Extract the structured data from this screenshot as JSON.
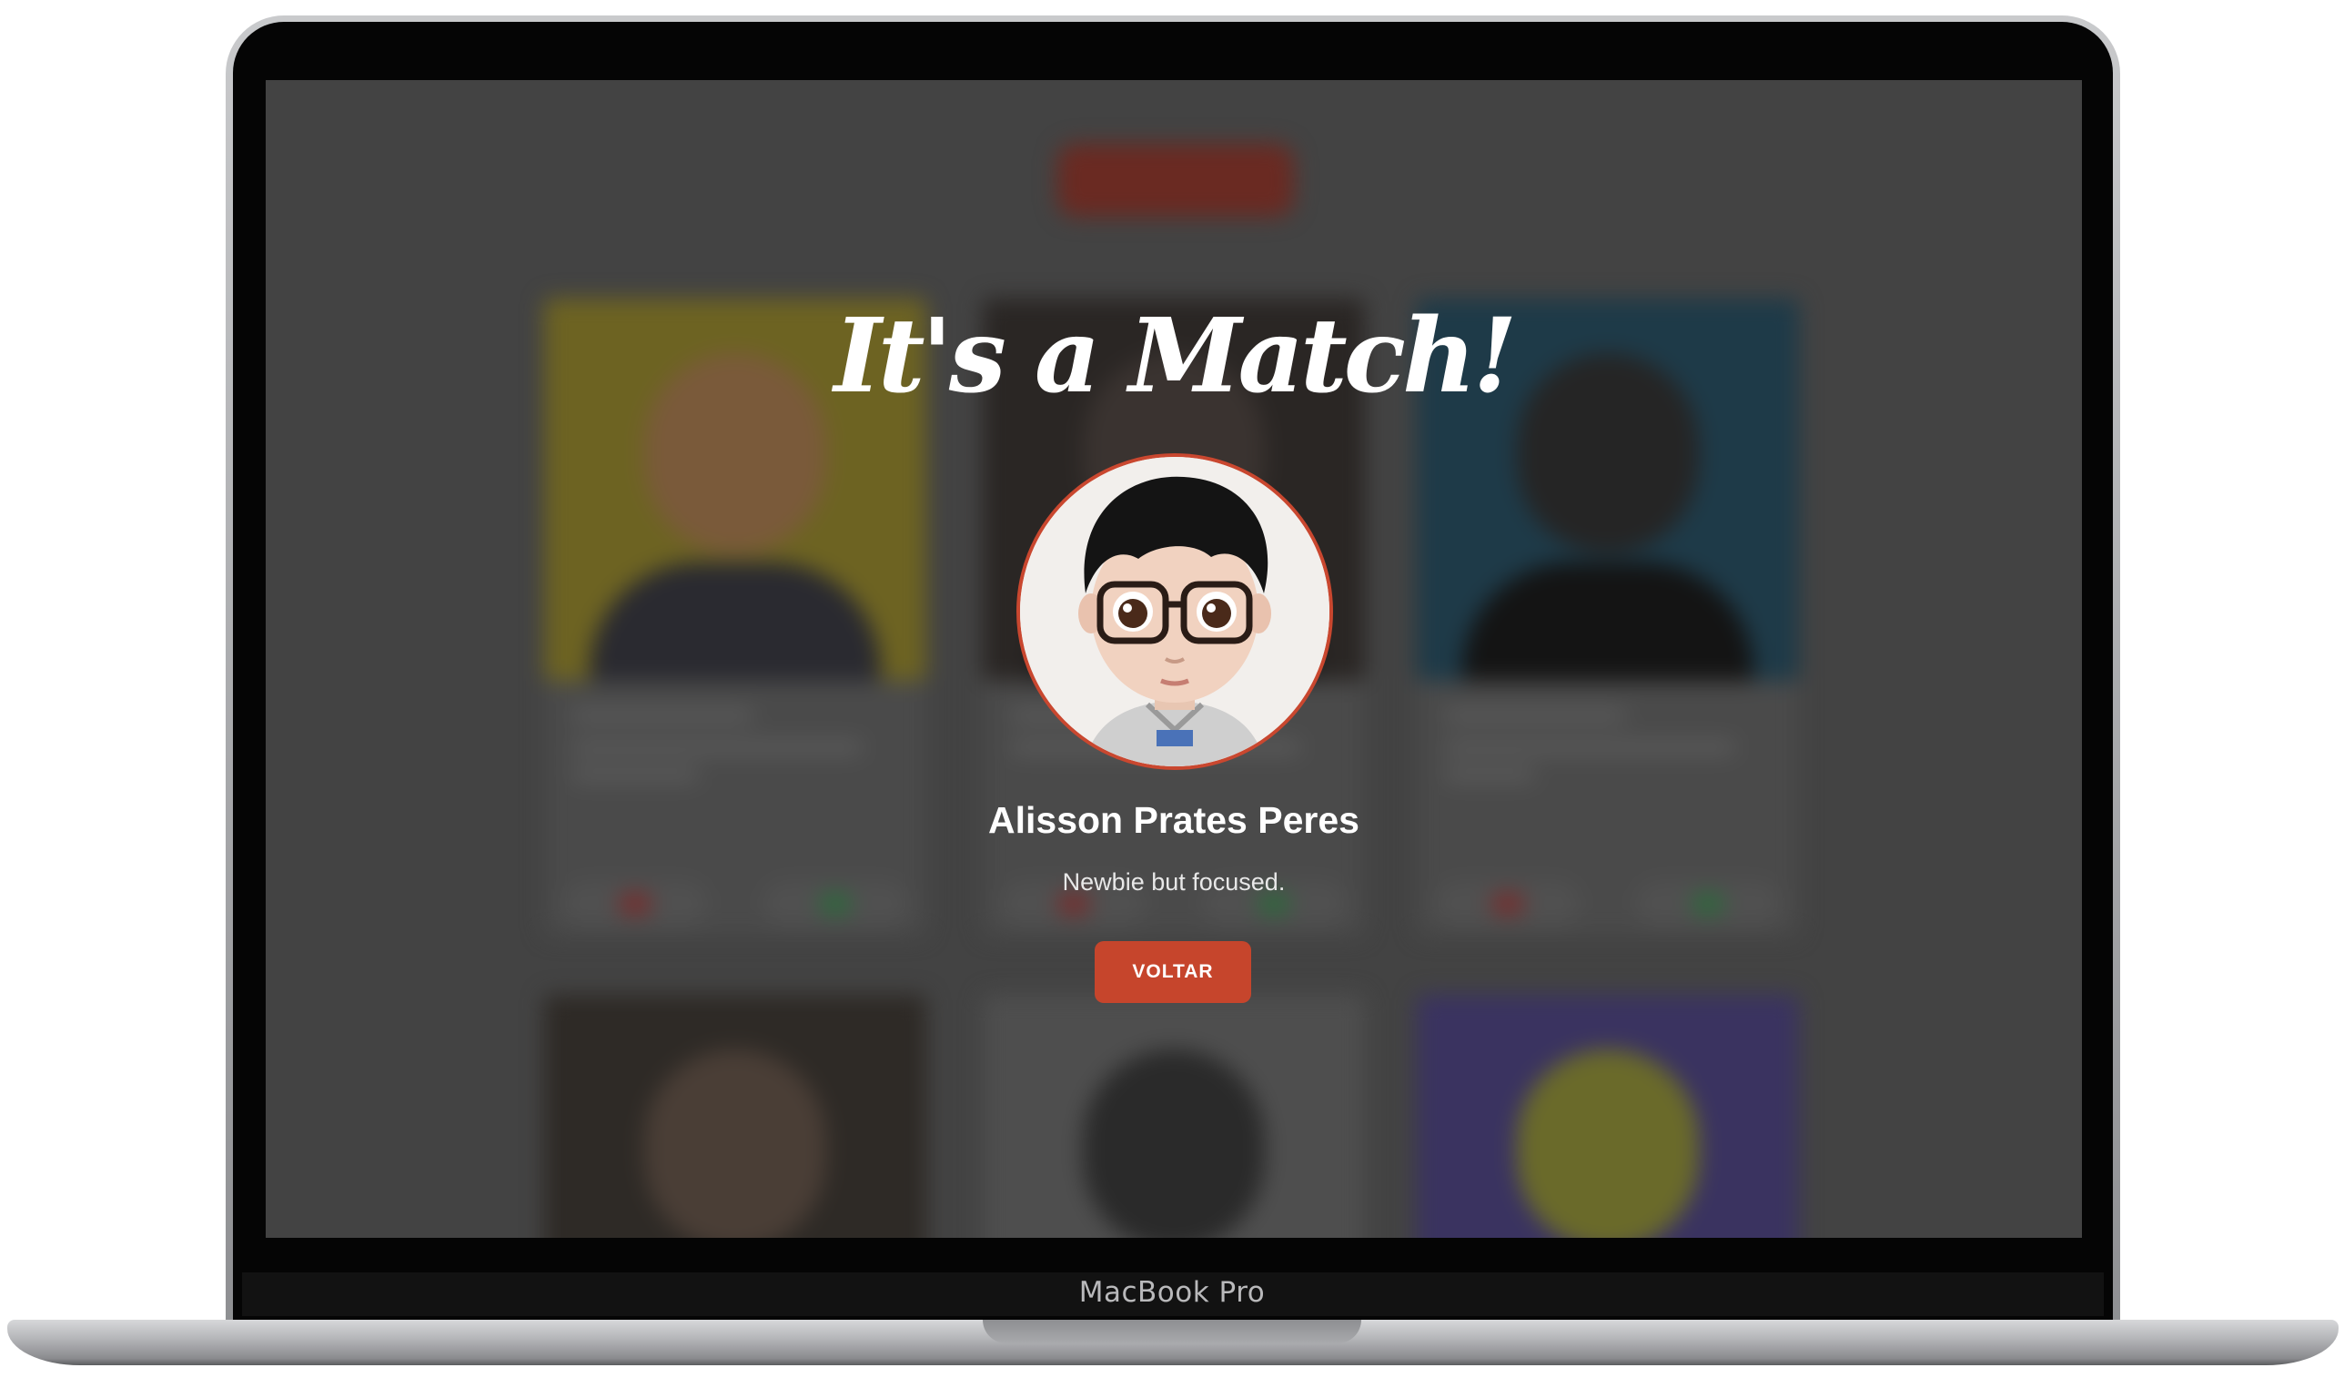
{
  "device": {
    "label": "MacBook Pro"
  },
  "modal": {
    "title": "It's a Match!",
    "name": "Alisson Prates Peres",
    "bio": "Newbie but focused.",
    "button_label": "VOLTAR"
  },
  "colors": {
    "accent": "#c6452c",
    "overlay": "#434343",
    "avatar_border": "#c9472f"
  }
}
